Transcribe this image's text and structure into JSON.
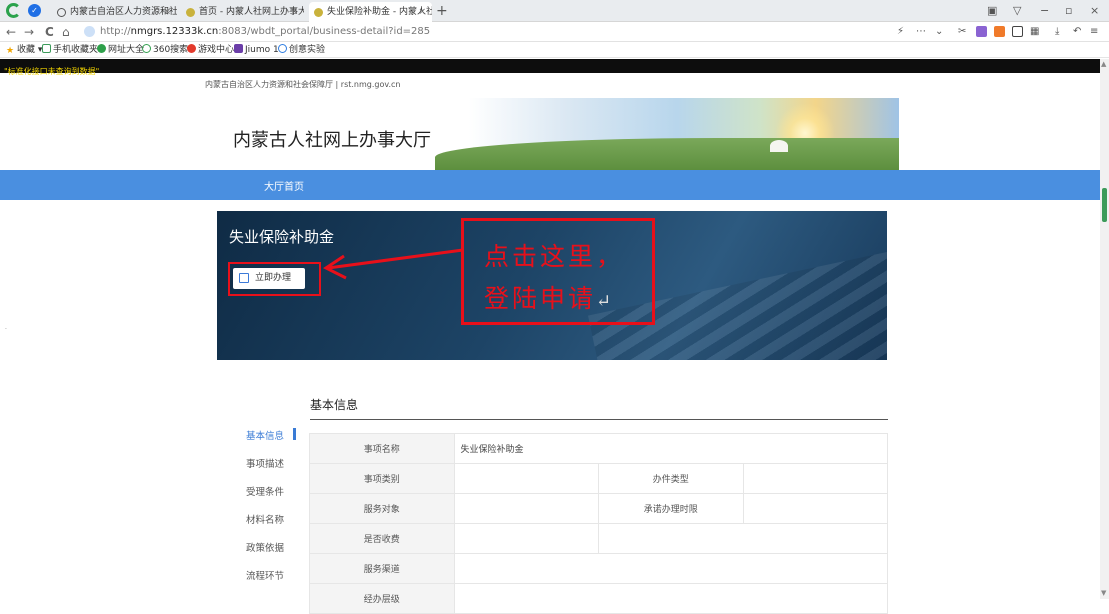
{
  "browser": {
    "tabs": [
      {
        "title": "内蒙古自治区人力资源和社会·"
      },
      {
        "title": "首页 - 内蒙人社网上办事大厅"
      },
      {
        "title": "失业保险补助金 - 内蒙人社网..."
      }
    ],
    "url_prefix": "http://",
    "url_host": "nmgrs.12333k.cn",
    "url_rest": ":8083/wbdt_portal/business-detail?id=285",
    "bookmarks": [
      "收藏",
      "手机收藏夹",
      "网址大全",
      "360搜索",
      "游戏中心",
      "Jiumo 1",
      "创意实验"
    ],
    "nav_glyphs": {
      "back": "←",
      "forward": "→",
      "reload": "C",
      "home": "⌂",
      "newtab": "+"
    }
  },
  "page": {
    "banner_strip": "\"标准化接口未查询到数据\"",
    "gov_line": "内蒙古自治区人力资源和社会保障厅 | rst.nmg.gov.cn",
    "site_title": "内蒙古人社网上办事大厅",
    "nav_home": "大厅首页",
    "hero_title": "失业保险补助金",
    "apply_button": "立即办理",
    "annotation_line1": "点击这里，",
    "annotation_line2": "登陆申请",
    "annotation_return_mark": "↵",
    "section_title": "基本信息",
    "side_nav": [
      "基本信息",
      "事项描述",
      "受理条件",
      "材料名称",
      "政策依据",
      "流程环节"
    ],
    "table": {
      "row1": {
        "label": "事项名称",
        "value": "失业保险补助金"
      },
      "row2": {
        "label1": "事项类别",
        "label2": "办件类型"
      },
      "row3": {
        "label1": "服务对象",
        "label2": "承诺办理时限"
      },
      "row4": {
        "label": "是否收费"
      },
      "row5": {
        "label": "服务渠道"
      },
      "row6": {
        "label": "经办层级"
      }
    }
  },
  "colors": {
    "accent_blue": "#4a8fe0",
    "annotation_red": "#e8101a"
  }
}
